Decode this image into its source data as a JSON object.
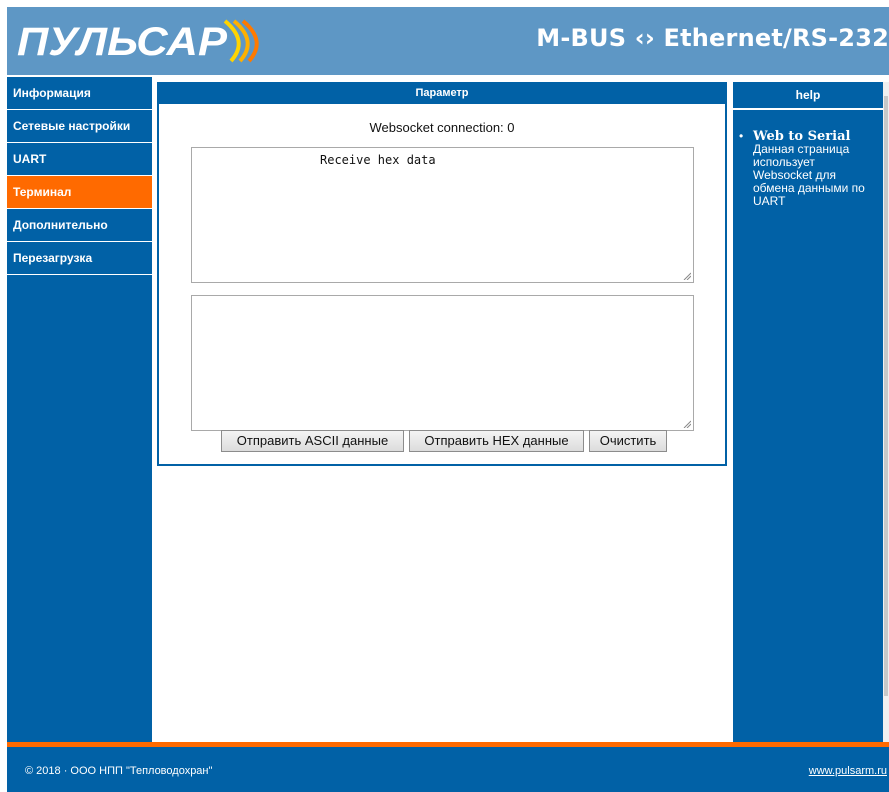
{
  "header": {
    "logo_text": "ПУЛЬСАР",
    "title": "M-BUS ‹› Ethernet/RS-232"
  },
  "sidebar": {
    "items": [
      {
        "label": "Информация"
      },
      {
        "label": "Сетевые настройки"
      },
      {
        "label": "UART"
      },
      {
        "label": "Терминал",
        "active": true
      },
      {
        "label": "Дополнительно"
      },
      {
        "label": "Перезагрузка"
      }
    ]
  },
  "main": {
    "header": "Параметр",
    "status": "Websocket connection: 0",
    "receive_text": "Receive hex data",
    "send_text": "",
    "buttons": {
      "send_ascii": "Отправить ASCII данные",
      "send_hex": "Отправить HEX данные",
      "clear": "Очистить"
    }
  },
  "help": {
    "header": "help",
    "title": "Web to Serial",
    "text": "Данная страница использует Websocket для обмена данными по UART"
  },
  "footer": {
    "copyright": "© 2018 · ООО НПП \"Тепловодохран\"",
    "link": "www.pulsarm.ru"
  },
  "colors": {
    "primary": "#0161a6",
    "header_bg": "#5e97c5",
    "active": "#ff6a00"
  }
}
